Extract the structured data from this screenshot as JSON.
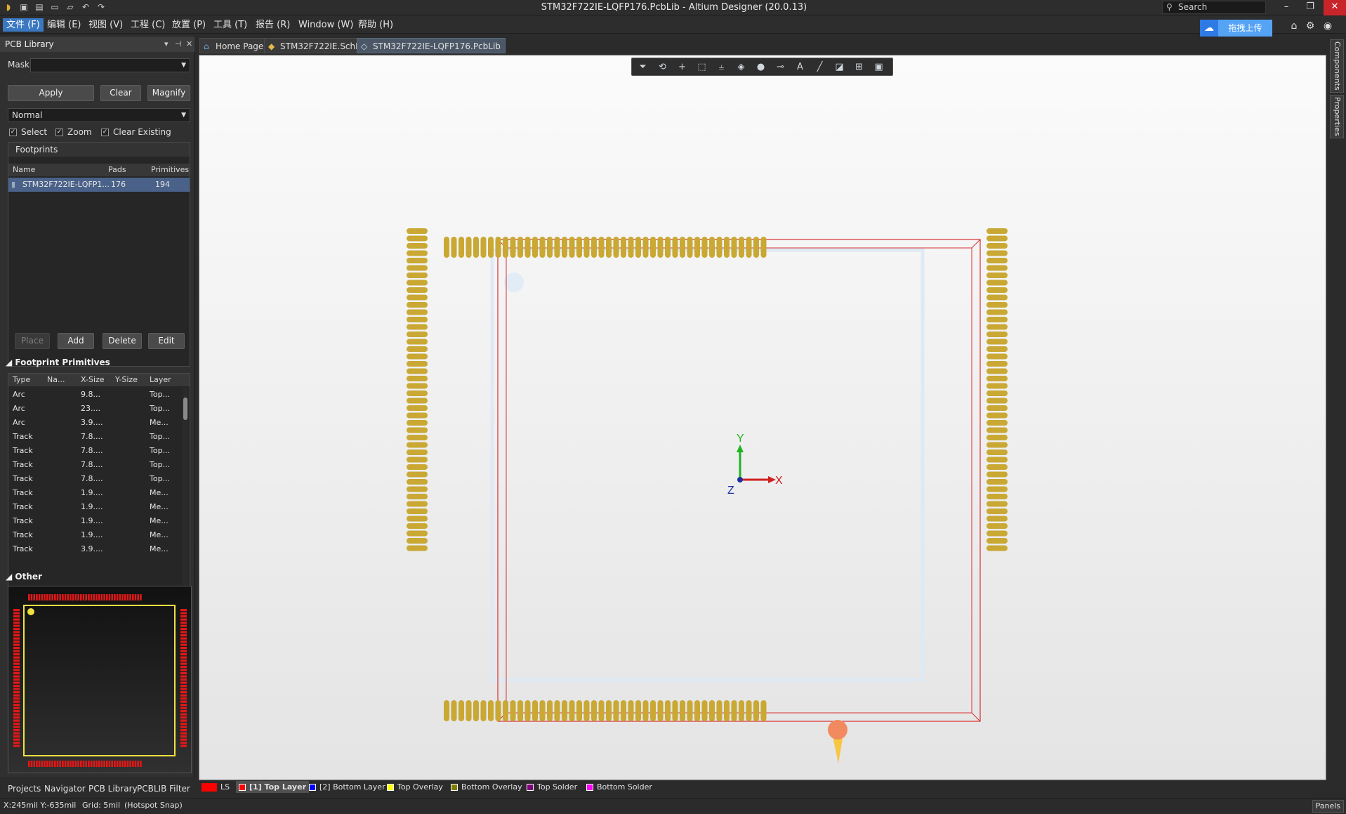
{
  "window": {
    "title": "STM32F722IE-LQFP176.PcbLib - Altium Designer (20.0.13)",
    "search_placeholder": "Search",
    "minimize": "–",
    "restore": "❐",
    "close": "✕"
  },
  "menus": [
    "文件 (F)",
    "编辑 (E)",
    "视图 (V)",
    "工程 (C)",
    "放置 (P)",
    "工具 (T)",
    "报告 (R)",
    "Window (W)",
    "帮助 (H)"
  ],
  "upload_button": "拖拽上传",
  "left_panel": {
    "title": "PCB Library",
    "mask_label": "Mask",
    "mask_value": "",
    "apply": "Apply",
    "clear": "Clear",
    "magnify": "Magnify",
    "mode": "Normal",
    "checks": [
      "Select",
      "Zoom",
      "Clear Existing"
    ],
    "footprints_label": "Footprints",
    "footprint_columns": [
      "Name",
      "Pads",
      "Primitives"
    ],
    "footprints": [
      {
        "name": "STM32F722IE-LQFP1...",
        "pads": "176",
        "primitives": "194"
      }
    ],
    "buttons": [
      "Place",
      "Add",
      "Delete",
      "Edit"
    ],
    "primitives_label": "Footprint Primitives",
    "primitive_columns": [
      "Type",
      "Na...",
      "X-Size",
      "Y-Size",
      "Layer"
    ],
    "primitives": [
      {
        "type": "Arc",
        "x": "9.8...",
        "layer": "Top..."
      },
      {
        "type": "Arc",
        "x": "23....",
        "layer": "Top..."
      },
      {
        "type": "Arc",
        "x": "3.9....",
        "layer": "Me..."
      },
      {
        "type": "Track",
        "x": "7.8....",
        "layer": "Top..."
      },
      {
        "type": "Track",
        "x": "7.8....",
        "layer": "Top..."
      },
      {
        "type": "Track",
        "x": "7.8....",
        "layer": "Top..."
      },
      {
        "type": "Track",
        "x": "7.8....",
        "layer": "Top..."
      },
      {
        "type": "Track",
        "x": "1.9....",
        "layer": "Me..."
      },
      {
        "type": "Track",
        "x": "1.9....",
        "layer": "Me..."
      },
      {
        "type": "Track",
        "x": "1.9....",
        "layer": "Me..."
      },
      {
        "type": "Track",
        "x": "1.9....",
        "layer": "Me..."
      },
      {
        "type": "Track",
        "x": "3.9....",
        "layer": "Me..."
      }
    ],
    "other_label": "Other"
  },
  "bottom_tabs": [
    "Projects",
    "Navigator",
    "PCB Library",
    "PCBLIB Filter"
  ],
  "doc_tabs": [
    "Home Page",
    "STM32F722IE.SchLib",
    "STM32F722IE-LQFP176.PcbLib"
  ],
  "right_tabs": [
    "Components",
    "Properties"
  ],
  "axes": {
    "x": "X",
    "y": "Y",
    "z": "Z"
  },
  "layers": [
    {
      "name": "LS",
      "color": "#ff0000"
    },
    {
      "name": "[1] Top Layer",
      "color": "#ff0000"
    },
    {
      "name": "[2] Bottom Layer",
      "color": "#0000ff"
    },
    {
      "name": "Top Overlay",
      "color": "#ffff00"
    },
    {
      "name": "Bottom Overlay",
      "color": "#808000"
    },
    {
      "name": "Top Solder",
      "color": "#800080"
    },
    {
      "name": "Bottom Solder",
      "color": "#ff00ff"
    }
  ],
  "status": {
    "coords": "X:245mil Y:-635mil",
    "grid": "Grid: 5mil",
    "snap": "(Hotspot Snap)",
    "panels": "Panels"
  },
  "colors": {
    "pad": "#c9a834",
    "courtyard": "#e02020",
    "accent": "#3b78c2"
  }
}
